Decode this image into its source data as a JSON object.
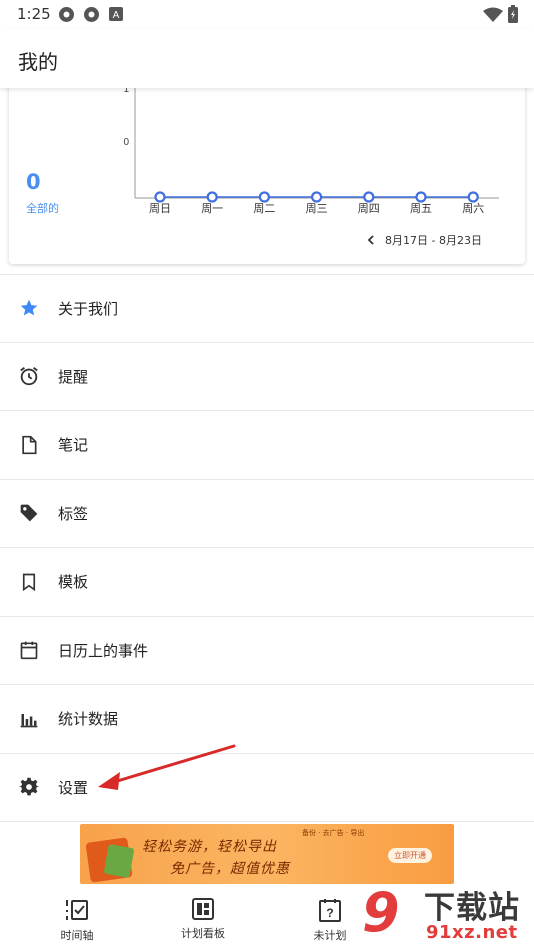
{
  "status_bar": {
    "time": "1:25"
  },
  "app_bar": {
    "title": "我的"
  },
  "summary": {
    "count": "0",
    "label": "全部的"
  },
  "chart_data": {
    "type": "line",
    "categories": [
      "周日",
      "周一",
      "周二",
      "周三",
      "周四",
      "周五",
      "周六"
    ],
    "series": [
      {
        "values": [
          0,
          0,
          0,
          0,
          0,
          0,
          0
        ]
      }
    ],
    "yticks": [
      "1",
      "0"
    ],
    "ylim": [
      0,
      1
    ],
    "color": "#3f6fe0"
  },
  "date_range": "8月17日 - 8月23日",
  "menu": [
    {
      "label": "关于我们",
      "icon": "star-icon"
    },
    {
      "label": "提醒",
      "icon": "alarm-icon"
    },
    {
      "label": "笔记",
      "icon": "note-icon"
    },
    {
      "label": "标签",
      "icon": "tag-icon"
    },
    {
      "label": "模板",
      "icon": "bookmark-icon"
    },
    {
      "label": "日历上的事件",
      "icon": "calendar-icon"
    },
    {
      "label": "统计数据",
      "icon": "bar-chart-icon"
    },
    {
      "label": "设置",
      "icon": "gear-icon"
    }
  ],
  "ad": {
    "line1": "轻松务游，轻松导出",
    "line2": "免广告，超值优惠",
    "tags": "备份 · 去广告 · 导出",
    "button": "立即开通"
  },
  "bottom_nav": [
    {
      "label": "时间轴",
      "icon": "timeline-icon"
    },
    {
      "label": "计划看板",
      "icon": "dashboard-icon"
    },
    {
      "label": "未计划",
      "icon": "question-icon"
    }
  ],
  "watermark": {
    "big": "9",
    "cn": "下载站",
    "url": "91xz.net"
  },
  "colors": {
    "accent": "#4a8ff0",
    "star": "#3d8af7",
    "arrow": "#d92a2a"
  }
}
